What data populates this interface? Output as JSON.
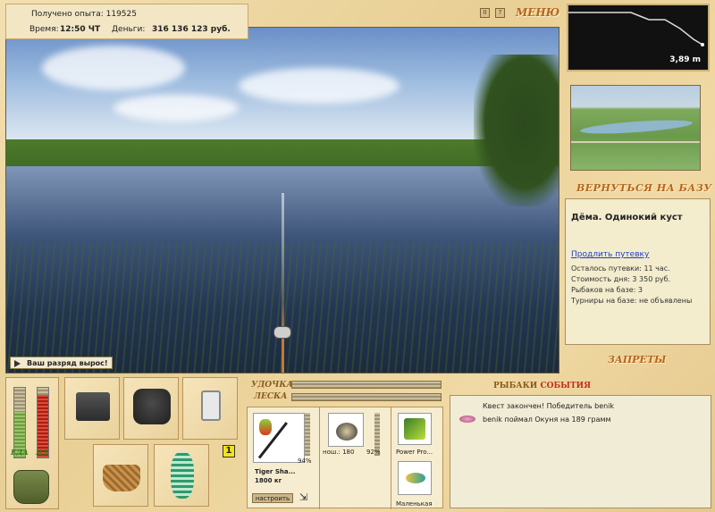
{
  "header": {
    "exp_label": "Получено опыта:",
    "exp_value": "119525",
    "time_label": "Время:",
    "time_value": "12:50 ЧТ",
    "money_label": "Деньги:",
    "money_value": "316 136 123 руб.",
    "menu_label": "МЕНЮ",
    "pause_icon_text": "II",
    "help_icon_text": "?"
  },
  "game": {
    "rank_message": "Ваш разряд вырос!"
  },
  "depth": {
    "value": "3,89 m"
  },
  "location": {
    "back_button": "ВЕРНУТЬСЯ НА БАЗУ",
    "title": "Дёма. Одинокий куст",
    "extend_link": "Продлить путевку",
    "lines": [
      "Осталось путевки: 11 час.",
      "Стоимость дня: 3 350 руб.",
      "Рыбаков на базе: 3",
      "Турниры на базе: не объявлены"
    ],
    "bans_button": "ЗАПРЕТЫ"
  },
  "status": {
    "food_label": "ЕДА",
    "poison_label": "ЯД",
    "food_level": 0.65,
    "poison_level": 0.9
  },
  "tackle": {
    "rod_label": "УДОЧКА",
    "line_label": "ЛЕСКА",
    "rod_name": "Tiger Sha...",
    "rod_weight": "1800 кг",
    "rod_percent": "94%",
    "reel_name": "нош.: 180",
    "reel_percent": "92%",
    "lure1_name": "Power Pro...",
    "lure2_name": "Маленькая",
    "setup_button": "настроить",
    "slot_number": "1"
  },
  "events": {
    "title_a": "РЫБАКИ",
    "title_b": "СОБЫТИЯ",
    "line1": "Квест закончен! Победитель benik",
    "line2": "benik поймал Окуня на 189 грамм"
  },
  "colors": {
    "accent": "#b5651d",
    "link": "#1f3ec9",
    "events_red": "#c0301c"
  }
}
